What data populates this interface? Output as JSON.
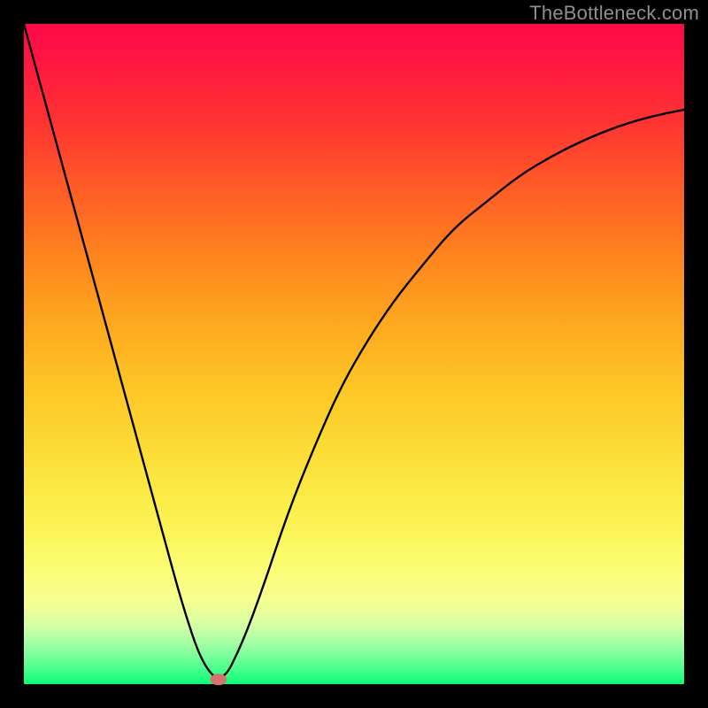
{
  "watermark": "TheBottleneck.com",
  "colors": {
    "page_bg": "#000000",
    "curve_stroke": "#000000",
    "marker_fill": "#d4746e",
    "watermark": "#8f8f8f"
  },
  "chart_data": {
    "type": "line",
    "title": "",
    "xlabel": "",
    "ylabel": "",
    "xlim": [
      0,
      100
    ],
    "ylim": [
      0,
      100
    ],
    "grid": false,
    "legend": false,
    "notes": "No axes, ticks, or labels visible. Values read from the curve in plot-percentage coordinates (0 = left/bottom, 100 = right/top). Background is a vertical red→green gradient.",
    "series": [
      {
        "name": "bottleneck-curve",
        "x": [
          0,
          3,
          6,
          9,
          12,
          15,
          18,
          21,
          24,
          27,
          30,
          33,
          36,
          40,
          44,
          48,
          52,
          56,
          60,
          65,
          70,
          75,
          80,
          85,
          90,
          95,
          100
        ],
        "y": [
          100,
          89,
          78,
          67,
          56,
          45,
          34,
          23,
          12,
          3,
          0,
          6,
          14,
          26,
          36,
          45,
          52,
          58,
          63,
          69,
          73,
          77,
          80,
          82.5,
          84.5,
          86,
          87
        ]
      }
    ],
    "markers": [
      {
        "name": "target-point",
        "x": 29.5,
        "y": 0.7,
        "rx": 1.3,
        "ry": 0.9
      }
    ]
  }
}
